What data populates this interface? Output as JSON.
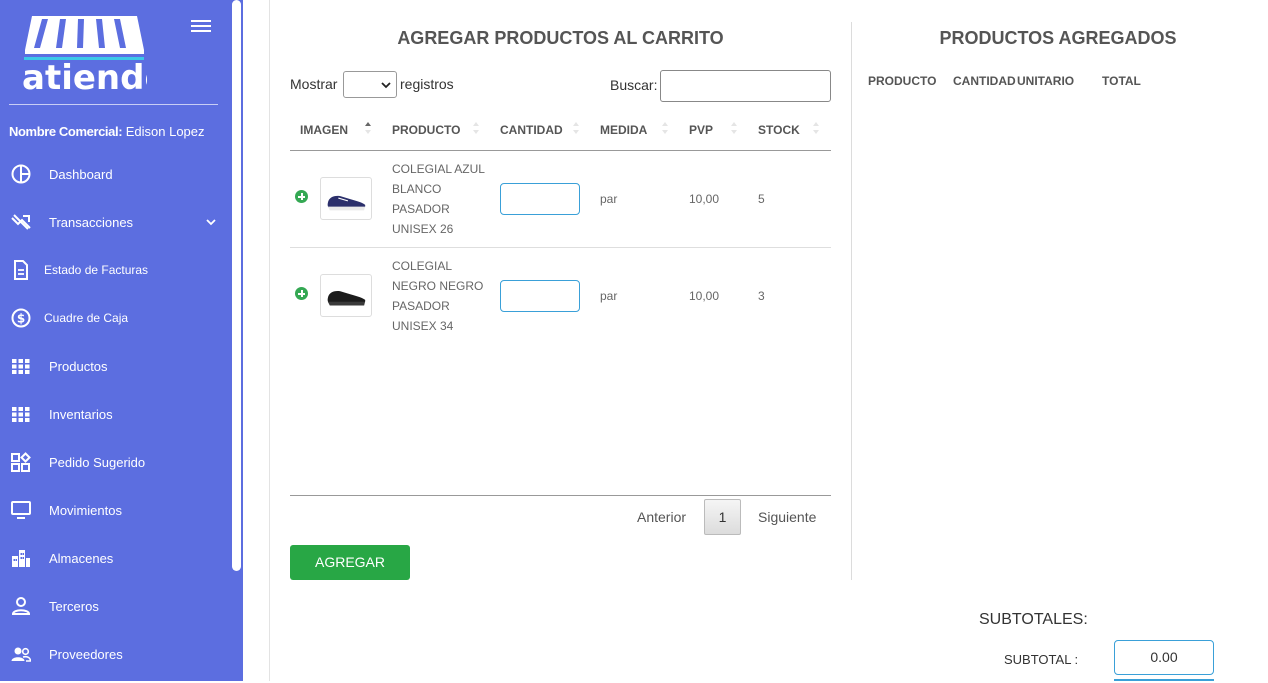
{
  "sidebar": {
    "logo_text": "atiendo",
    "merchant_label": "Nombre Comercial:",
    "merchant_name": " Edison Lopez",
    "items": [
      {
        "label": "Dashboard",
        "icon": "pie-chart-icon"
      },
      {
        "label": "Transacciones",
        "icon": "transactions-icon"
      },
      {
        "label": "Estado de Facturas",
        "icon": "document-icon"
      },
      {
        "label": "Cuadre de Caja",
        "icon": "dollar-circle-icon"
      },
      {
        "label": "Productos",
        "icon": "grid-icon"
      },
      {
        "label": "Inventarios",
        "icon": "grid-icon"
      },
      {
        "label": "Pedido Sugerido",
        "icon": "widgets-icon"
      },
      {
        "label": "Movimientos",
        "icon": "monitor-icon"
      },
      {
        "label": "Almacenes",
        "icon": "buildings-icon"
      },
      {
        "label": "Terceros",
        "icon": "person-icon"
      },
      {
        "label": "Proveedores",
        "icon": "people-icon"
      }
    ]
  },
  "left_panel": {
    "title": "AGREGAR PRODUCTOS AL CARRITO",
    "show_label": "Mostrar",
    "show_suffix": "registros",
    "search_label": "Buscar:",
    "columns": [
      "IMAGEN",
      "PRODUCTO",
      "CANTIDAD",
      "MEDIDA",
      "PVP",
      "STOCK"
    ],
    "rows": [
      {
        "product_lines": [
          "COLEGIAL AZUL",
          "BLANCO",
          "PASADOR",
          "UNISEX 26"
        ],
        "medida": "par",
        "pvp": "10,00",
        "stock": "5",
        "image": "blue-sneaker"
      },
      {
        "product_lines": [
          "COLEGIAL",
          "NEGRO NEGRO",
          "PASADOR",
          "UNISEX 34"
        ],
        "medida": "par",
        "pvp": "10,00",
        "stock": "3",
        "image": "black-sneaker"
      }
    ],
    "pagination": {
      "prev": "Anterior",
      "page": "1",
      "next": "Siguiente"
    },
    "add_button": "AGREGAR"
  },
  "right_panel": {
    "title": "PRODUCTOS AGREGADOS",
    "columns": [
      "PRODUCTO",
      "CANTIDAD",
      "UNITARIO",
      "TOTAL"
    ]
  },
  "totals": {
    "subtotals_label": "SUBTOTALES:",
    "subtotal_label": "SUBTOTAL :",
    "subtotal_value": "0.00"
  },
  "colors": {
    "sidebar_bg": "#5c6ee0",
    "accent_green": "#28a745",
    "input_border": "#3aa0d8"
  }
}
